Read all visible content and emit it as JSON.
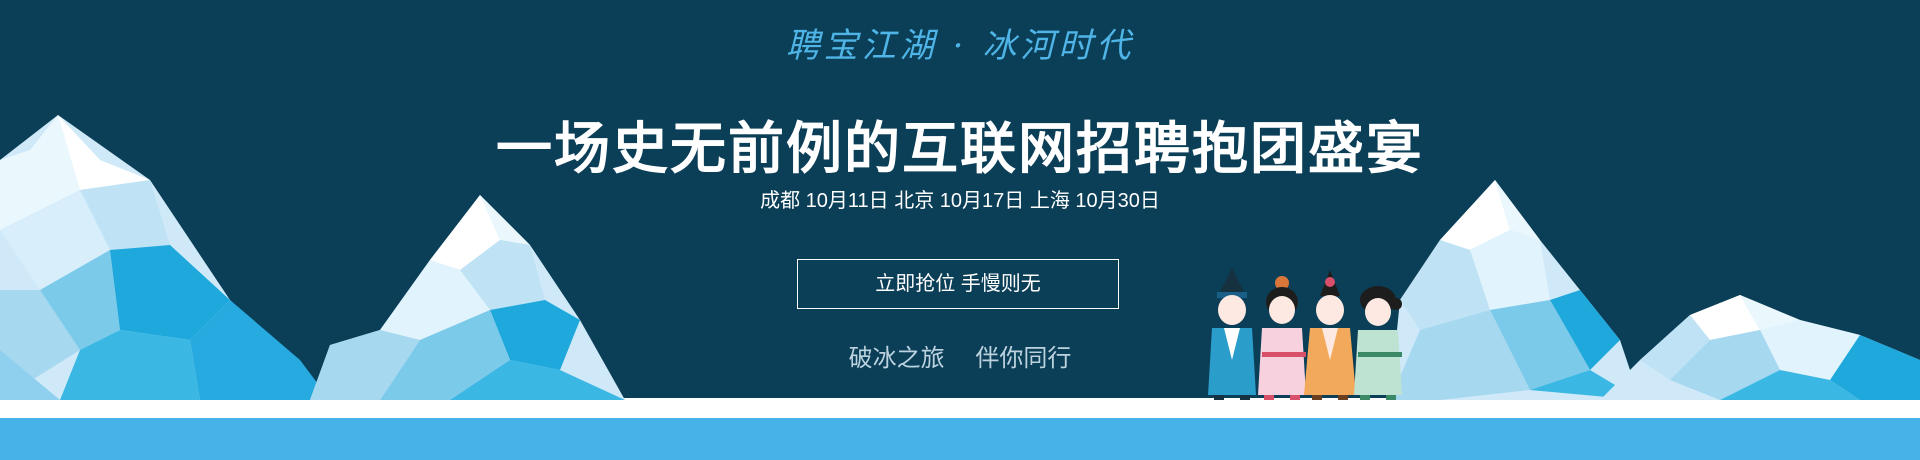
{
  "banner": {
    "tagline": "聘宝江湖 · 冰河时代",
    "headline": "一场史无前例的互联网招聘抱团盛宴",
    "dates": "成都 10月11日  北京 10月17日  上海 10月30日",
    "cta_label": "立即抢位 手慢则无",
    "slogan_left": "破冰之旅",
    "slogan_right": "伴你同行"
  },
  "colors": {
    "background": "#0b3e57",
    "tagline": "#4fb4e6",
    "strip": "#45b3e7",
    "ice_dark": "#1fa8dc",
    "ice_light": "#e8f6fd"
  },
  "illustration": {
    "figures": [
      "swordsman-figure",
      "pink-dress-girl-figure",
      "orange-robe-figure",
      "green-robe-girl-figure"
    ]
  }
}
